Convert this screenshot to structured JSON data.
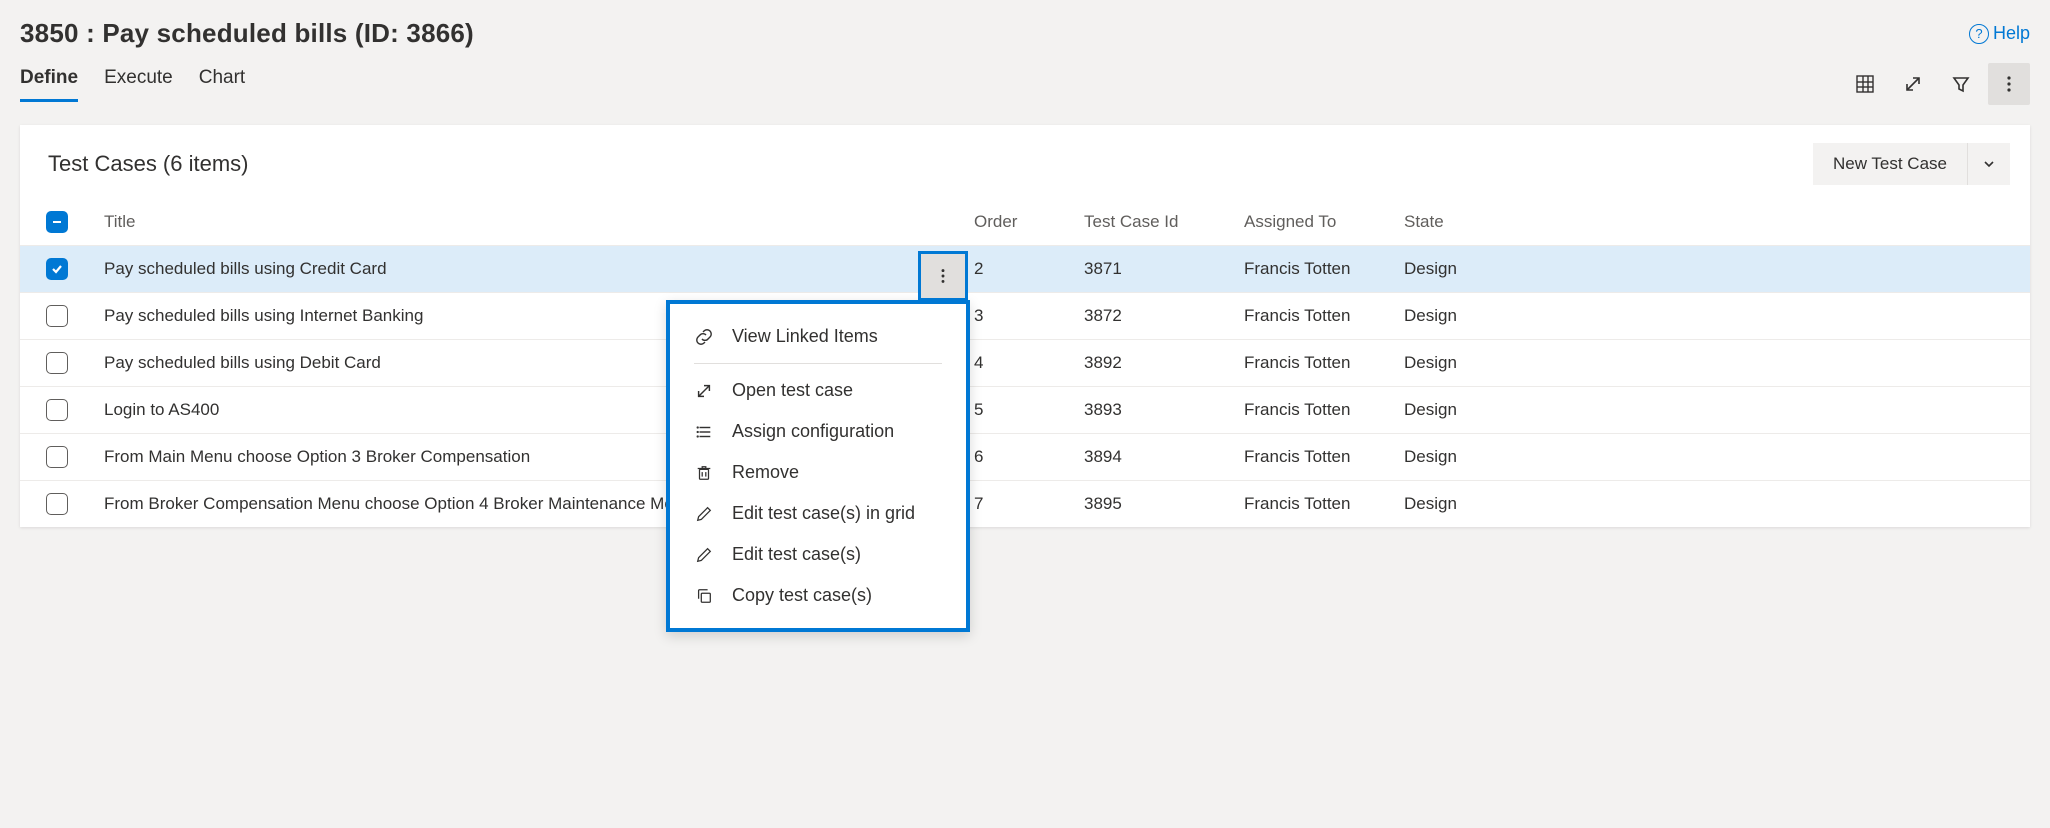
{
  "header": {
    "title": "3850 : Pay scheduled bills (ID: 3866)",
    "help": "Help"
  },
  "tabs": {
    "define": "Define",
    "execute": "Execute",
    "chart": "Chart",
    "activeIndex": 0
  },
  "toolbar": {
    "grid_tip": "Grid view",
    "expand_tip": "Full screen",
    "filter_tip": "Filter",
    "more_tip": "More actions"
  },
  "panel": {
    "title": "Test Cases (6 items)",
    "new_case_label": "New Test Case",
    "columns": {
      "title": "Title",
      "order": "Order",
      "tcid": "Test Case Id",
      "assigned": "Assigned To",
      "state": "State"
    },
    "header_check_state": "indeterminate",
    "rows": [
      {
        "selected": true,
        "title": "Pay scheduled bills using Credit Card",
        "order": "2",
        "tcid": "3871",
        "assigned": "Francis Totten",
        "state": "Design"
      },
      {
        "selected": false,
        "title": "Pay scheduled bills using Internet Banking",
        "order": "3",
        "tcid": "3872",
        "assigned": "Francis Totten",
        "state": "Design"
      },
      {
        "selected": false,
        "title": "Pay scheduled bills using Debit Card",
        "order": "4",
        "tcid": "3892",
        "assigned": "Francis Totten",
        "state": "Design"
      },
      {
        "selected": false,
        "title": "Login to AS400",
        "order": "5",
        "tcid": "3893",
        "assigned": "Francis Totten",
        "state": "Design"
      },
      {
        "selected": false,
        "title": "From Main Menu choose Option 3 Broker Compensation",
        "order": "6",
        "tcid": "3894",
        "assigned": "Francis Totten",
        "state": "Design"
      },
      {
        "selected": false,
        "title": "From Broker Compensation Menu choose Option 4 Broker Maintenance Menu",
        "order": "7",
        "tcid": "3895",
        "assigned": "Francis Totten",
        "state": "Design"
      }
    ]
  },
  "context_menu": {
    "items": [
      {
        "icon": "link-icon",
        "label": "View Linked Items"
      },
      {
        "separator": true
      },
      {
        "icon": "open-icon",
        "label": "Open test case"
      },
      {
        "icon": "config-icon",
        "label": "Assign configuration"
      },
      {
        "icon": "trash-icon",
        "label": "Remove"
      },
      {
        "icon": "edit-icon",
        "label": "Edit test case(s) in grid"
      },
      {
        "icon": "edit-icon",
        "label": "Edit test case(s)"
      },
      {
        "icon": "copy-icon",
        "label": "Copy test case(s)"
      }
    ]
  },
  "colors": {
    "accent": "#0078d4",
    "row_selected": "#dcecf9"
  }
}
